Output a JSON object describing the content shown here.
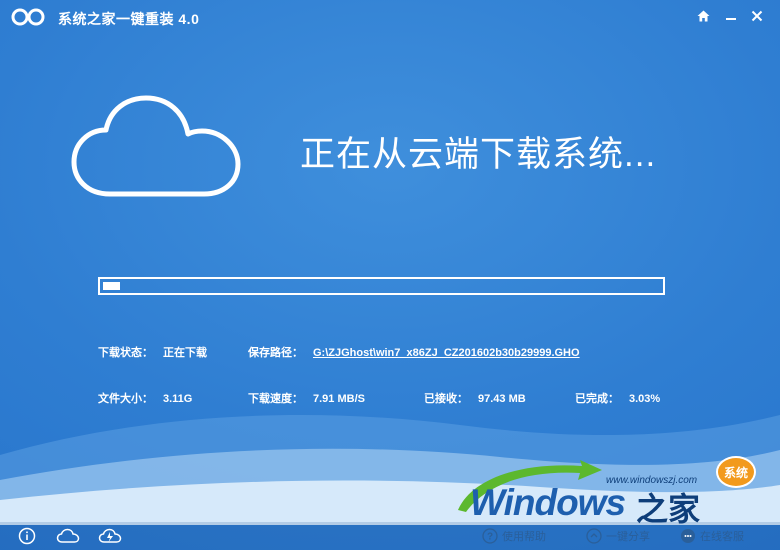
{
  "window": {
    "title": "系统之家一键重装  4.0"
  },
  "main": {
    "heading": "正在从云端下载系统...",
    "progress_percent": 3.03
  },
  "info": {
    "status_label": "下载状态：",
    "status_value": "正在下载",
    "path_label": "保存路径：",
    "path_value": "G:\\ZJGhost\\win7_x86ZJ_CZ201602b30b29999.GHO",
    "size_label": "文件大小：",
    "size_value": "3.11G",
    "speed_label": "下载速度：",
    "speed_value": "7.91 MB/S",
    "received_label": "已接收：",
    "received_value": "97.43 MB",
    "done_label": "已完成：",
    "done_value": "3.03%"
  },
  "brand": {
    "url": "www.windowszj.com",
    "badge": "系统",
    "windows": "Windows",
    "zhijia": "之家"
  },
  "footer": {
    "help": "使用帮助",
    "share": "一键分享",
    "support": "在线客服"
  },
  "colors": {
    "background": "#2f7ed2",
    "accent": "#ffffff",
    "badge": "#f29a1d"
  }
}
